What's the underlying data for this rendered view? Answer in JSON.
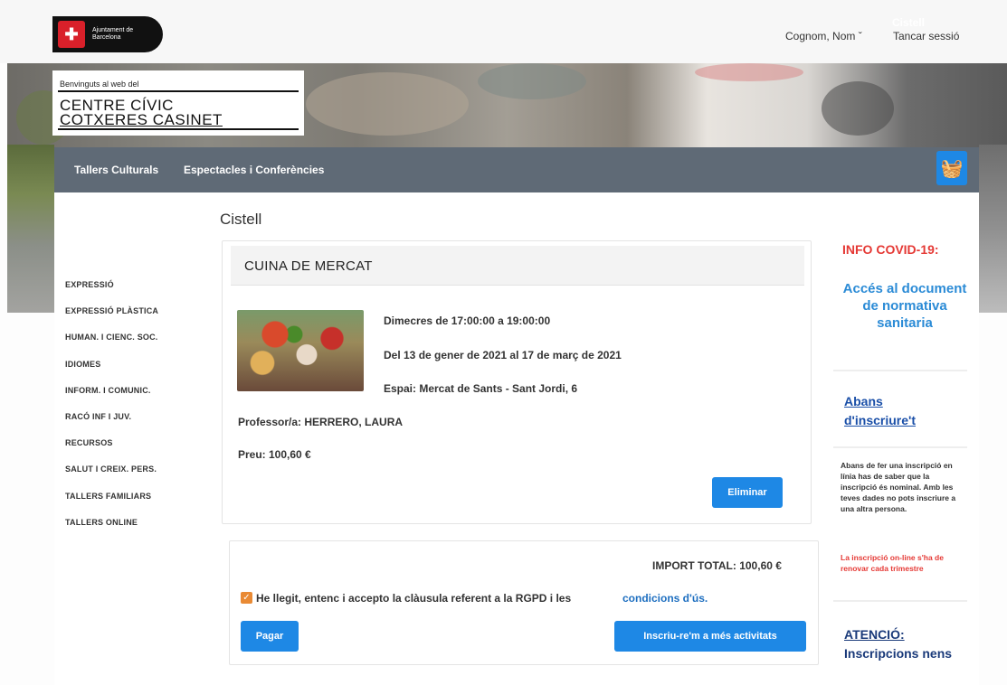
{
  "header": {
    "logo_text_line1": "Ajuntament de",
    "logo_text_line2": "Barcelona",
    "user_menu": "Cognom, Nom ˇ",
    "logout": "Tancar sessió"
  },
  "banner": {
    "welcome": "Benvinguts al web del",
    "centre_line1": "CENTRE CÍVIC",
    "centre_line2": "COTXERES CASINET"
  },
  "nav": {
    "items": [
      "Tallers Culturals",
      "Espectacles i Conferències"
    ],
    "cart_label": "Cistell",
    "cart_icon": "basket-icon"
  },
  "sidebar": {
    "items": [
      "EXPRESSIÓ",
      "EXPRESSIÓ PLÀSTICA",
      "HUMAN. I CIENC. SOC.",
      "IDIOMES",
      "INFORM. I COMUNIC.",
      "RACÓ INF I JUV.",
      "RECURSOS",
      "SALUT I CREIX. PERS.",
      "TALLERS FAMILIARS",
      "TALLERS ONLINE"
    ]
  },
  "main": {
    "title": "Cistell",
    "course": {
      "name": "CUINA DE MERCAT",
      "schedule": "Dimecres de 17:00:00 a 19:00:00",
      "dates": "Del 13 de gener de 2021 al 17 de març de 2021",
      "place": "Espai: Mercat de Sants - Sant Jordi, 6",
      "teacher": "Professor/a: HERRERO, LAURA",
      "price": "Preu: 100,60 €",
      "remove_label": "Eliminar"
    },
    "total": "IMPORT TOTAL: 100,60 €",
    "accept_text": "He llegit, entenc i accepto la clàusula referent a la RGPD i les",
    "terms_link": "condicions d'ús.",
    "accept_checked": true,
    "pay_label": "Pagar",
    "more_label": "Inscriu-re'm a més activitats"
  },
  "right_column": {
    "covid_title": "INFO COVID-19:",
    "covid_link": "Accés al document de normativa sanitaria",
    "before_heading": "Abans d'inscriure't",
    "before_text": "Abans de fer una inscripció en línia has de saber que la inscripció és nominal. Amb les teves dades no pots inscriure a una altra persona.",
    "before_warning": "La inscripció on-line s'ha de renovar cada trimestre",
    "attention_underlined": "ATENCIÓ:",
    "attention_rest": "Inscripcions nens"
  },
  "colors": {
    "primary_button": "#1e88e5",
    "nav_background": "#5f6a76",
    "alert_red": "#e53935",
    "checkbox_orange": "#e98a34"
  }
}
